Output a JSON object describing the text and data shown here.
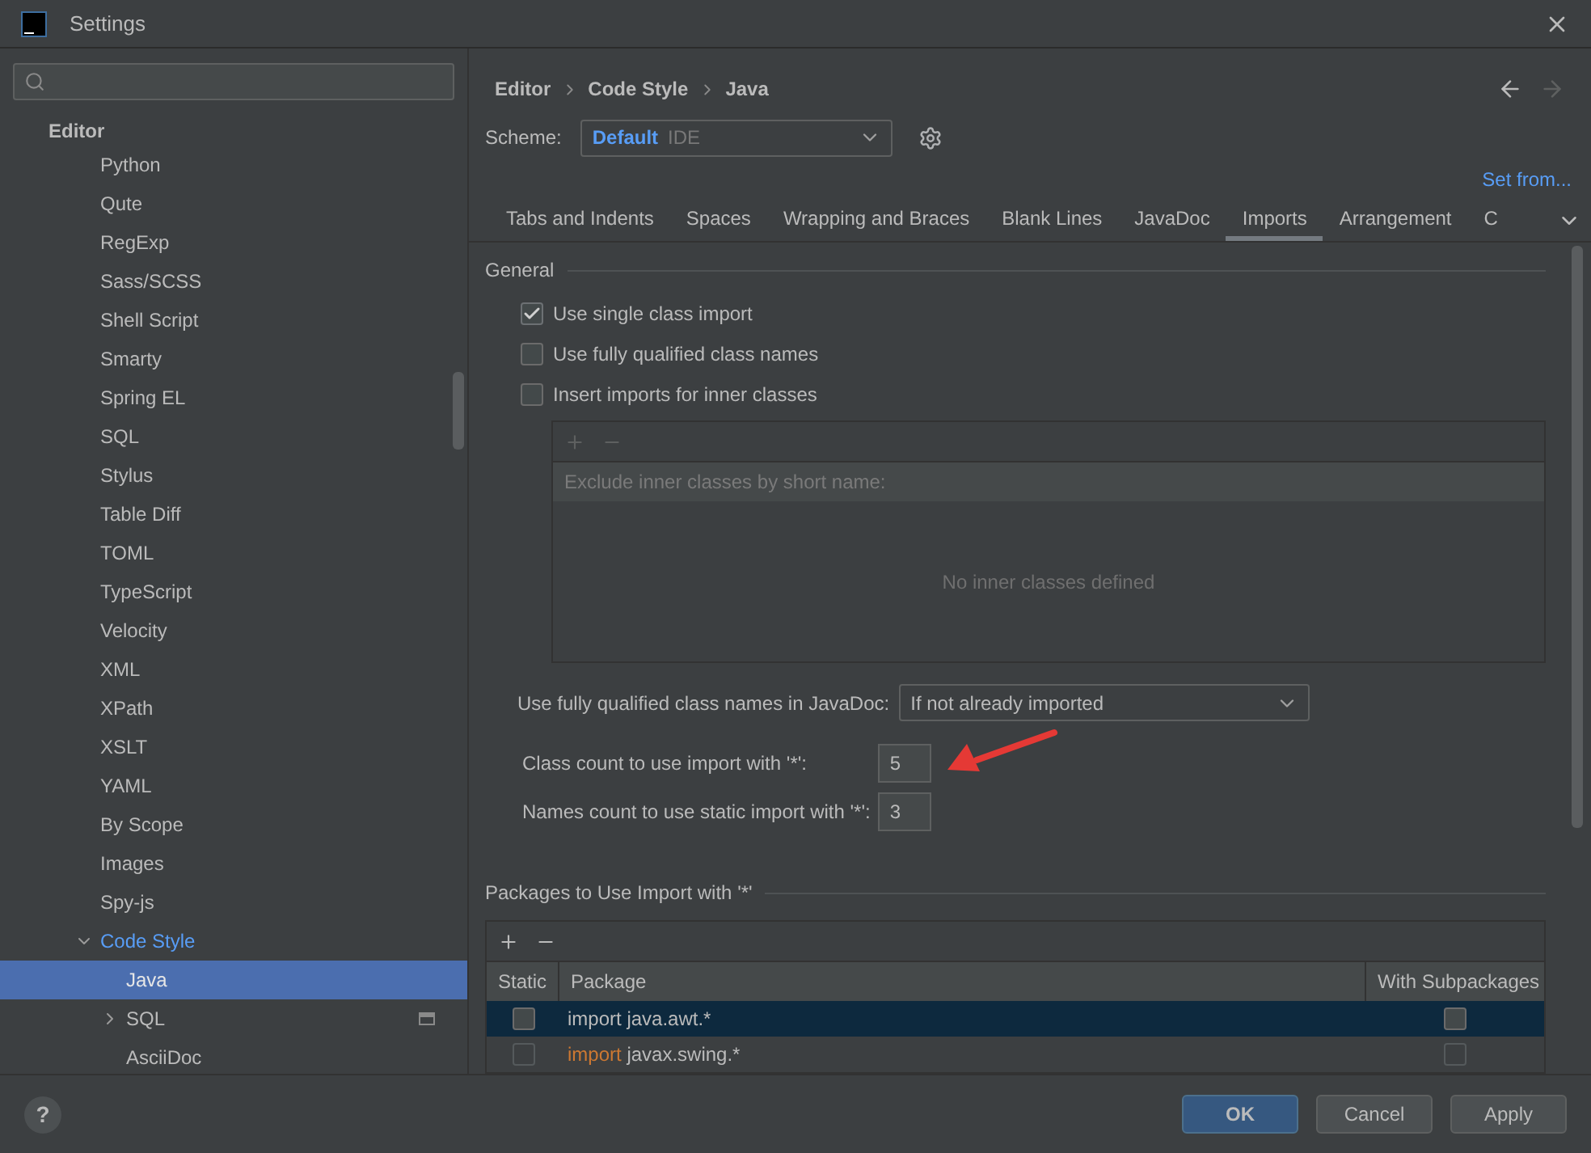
{
  "window": {
    "title": "Settings"
  },
  "sidebar": {
    "tree": [
      {
        "label": "Editor",
        "children": [
          {
            "label": "Python",
            "selected": false
          },
          {
            "label": "Qute",
            "selected": false
          },
          {
            "label": "RegExp",
            "selected": false
          },
          {
            "label": "Sass/SCSS",
            "selected": false
          },
          {
            "label": "Shell Script",
            "selected": false
          },
          {
            "label": "Smarty",
            "selected": false
          },
          {
            "label": "Spring EL",
            "selected": false
          },
          {
            "label": "SQL",
            "selected": false
          },
          {
            "label": "Stylus",
            "selected": false
          },
          {
            "label": "Table Diff",
            "selected": false
          },
          {
            "label": "TOML",
            "selected": false
          },
          {
            "label": "TypeScript",
            "selected": false
          },
          {
            "label": "Velocity",
            "selected": false
          },
          {
            "label": "XML",
            "selected": false
          },
          {
            "label": "XPath",
            "selected": false
          },
          {
            "label": "XSLT",
            "selected": false
          },
          {
            "label": "YAML",
            "selected": false
          },
          {
            "label": "By Scope",
            "selected": false
          },
          {
            "label": "Images",
            "selected": false
          },
          {
            "label": "Spy-js",
            "selected": false
          },
          {
            "label": "Code Style",
            "selected": false,
            "expanded": true,
            "children": [
              {
                "label": "Java",
                "selected": true
              },
              {
                "label": "SQL",
                "selected": false,
                "expanded": false,
                "project_level": true
              },
              {
                "label": "AsciiDoc",
                "selected": false
              }
            ]
          }
        ]
      }
    ]
  },
  "breadcrumb": [
    "Editor",
    "Code Style",
    "Java"
  ],
  "scheme": {
    "label": "Scheme:",
    "name": "Default",
    "scope": "IDE"
  },
  "set_from": "Set from...",
  "tabs": [
    {
      "label": "Tabs and Indents",
      "selected": false
    },
    {
      "label": "Spaces",
      "selected": false
    },
    {
      "label": "Wrapping and Braces",
      "selected": false
    },
    {
      "label": "Blank Lines",
      "selected": false
    },
    {
      "label": "JavaDoc",
      "selected": false
    },
    {
      "label": "Imports",
      "selected": true
    },
    {
      "label": "Arrangement",
      "selected": false
    },
    {
      "label": "C",
      "selected": false
    }
  ],
  "general": {
    "title": "General",
    "options": [
      {
        "label": "Use single class import",
        "checked": true
      },
      {
        "label": "Use fully qualified class names",
        "checked": false
      },
      {
        "label": "Insert imports for inner classes",
        "checked": false
      }
    ],
    "inner_table": {
      "header": "Exclude inner classes by short name:",
      "empty_text": "No inner classes defined"
    },
    "javadoc": {
      "label": "Use fully qualified class names in JavaDoc:",
      "value": "If not already imported"
    },
    "counts": [
      {
        "label": "Class count to use import with '*':",
        "value": "5"
      },
      {
        "label": "Names count to use static import with '*':",
        "value": "3"
      }
    ]
  },
  "packages": {
    "title": "Packages to Use Import with '*'",
    "columns": [
      "Static",
      "Package",
      "With Subpackages"
    ],
    "rows": [
      {
        "static": false,
        "keyword": "import",
        "package": "java.awt.*",
        "with_subpackages": false,
        "selected": true
      },
      {
        "static": false,
        "keyword": "import",
        "package": "javax.swing.*",
        "with_subpackages": false,
        "selected": false
      }
    ]
  },
  "help": "?",
  "buttons": [
    {
      "label": "OK",
      "kind": "primary"
    },
    {
      "label": "Cancel",
      "kind": "secondary"
    },
    {
      "label": "Apply",
      "kind": "secondary"
    }
  ]
}
